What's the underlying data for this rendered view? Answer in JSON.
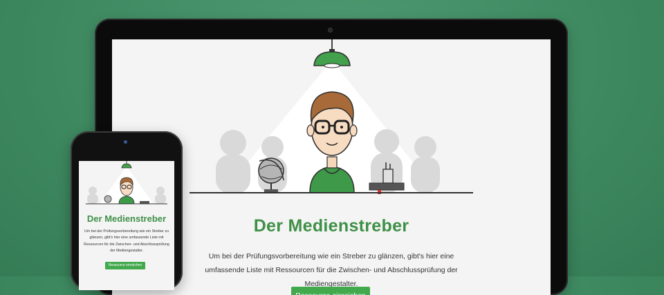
{
  "hero": {
    "title": "Der Medienstreber",
    "description": "Um bei der Prüfungsvorbereitung wie ein Streber zu glänzen, gibt's hier eine umfassende Liste mit Ressourcen für die Zwischen- und Abschlussprüfung der Mediengestalter.",
    "cta_label": "Ressource einreichen"
  },
  "illustration": {
    "icons": [
      "lamp-icon",
      "nerd-character-icon",
      "globe-icon",
      "book-icon",
      "pencil-cup-icon",
      "audience-silhouette-icon"
    ]
  },
  "colors": {
    "background": "#3f8a61",
    "accent": "#42a94d",
    "title": "#3e9047"
  }
}
